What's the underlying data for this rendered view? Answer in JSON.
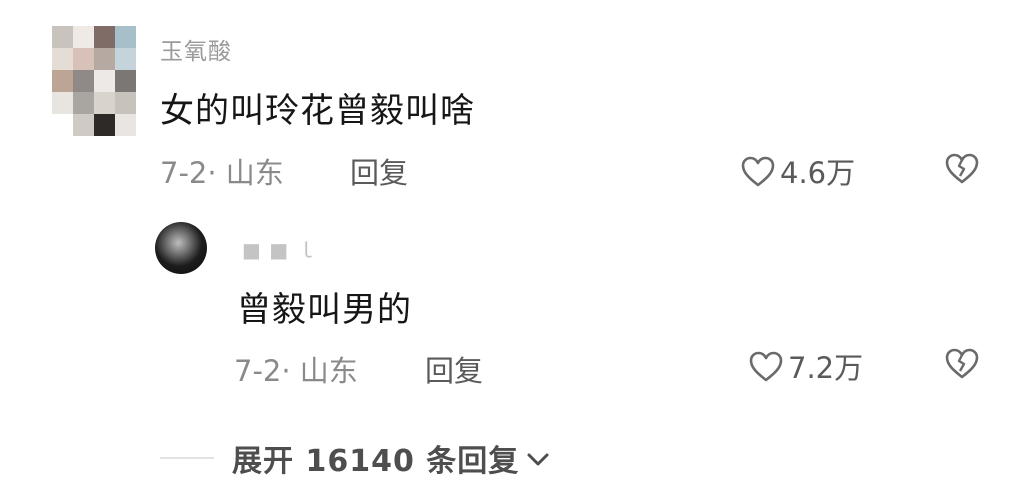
{
  "comment": {
    "username": "玉氧酸",
    "text": "女的叫玲花曾毅叫啥",
    "meta": "7-2· 山东",
    "reply_label": "回复",
    "likes": "4.6万",
    "avatar_icon": "blurred-avatar-icon"
  },
  "reply": {
    "username": "■ ■ ｌ",
    "text": "曾毅叫男的",
    "meta": "7-2· 山东",
    "reply_label": "回复",
    "likes": "7.2万",
    "avatar_icon": "dark-avatar-icon"
  },
  "expand": {
    "label": "展开 16140 条回复",
    "icon": "chevron-down-icon"
  },
  "icons": {
    "like": "heart-outline-icon",
    "dislike": "broken-heart-icon"
  },
  "colors": {
    "text_primary": "#161616",
    "text_secondary": "#8a8a8a",
    "action": "#5a5a5a"
  }
}
